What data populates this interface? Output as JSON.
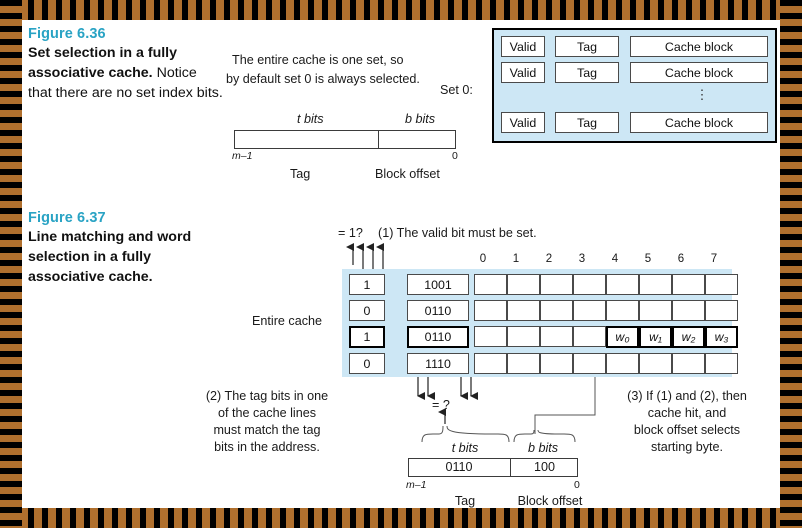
{
  "page": {
    "frame_color_dark": "#000000",
    "frame_color_orange": "#b0702e",
    "cache_fill_color": "#cde7f5",
    "figure_number_color": "#29a3c4"
  },
  "figure_636": {
    "number": "Figure 6.36",
    "caption_bold": "Set selection in a fully associative cache.",
    "caption_rest": " Notice that there are no set index bits.",
    "note_line1": "The entire cache is one set, so",
    "note_line2": "by default set 0 is always selected.",
    "set_label": "Set 0:",
    "address": {
      "t_bits_label": "t bits",
      "b_bits_label": "b bits",
      "left_end_label": "m–1",
      "right_end_label": "0",
      "tag_label": "Tag",
      "block_offset_label": "Block offset"
    },
    "cache_rows": [
      {
        "valid": "Valid",
        "tag": "Tag",
        "block": "Cache block"
      },
      {
        "valid": "Valid",
        "tag": "Tag",
        "block": "Cache block"
      },
      {
        "valid": "Valid",
        "tag": "Tag",
        "block": "Cache block"
      }
    ],
    "ellipsis": "⋮"
  },
  "figure_637": {
    "number": "Figure 6.37",
    "caption_bold": "Line matching and word selection in a fully associative cache.",
    "caption_rest": "",
    "entire_cache_label": "Entire cache",
    "valid_check_label": "= 1?",
    "tag_check_label": "= ?",
    "note1": "(1) The valid bit must be set.",
    "note2_lines": [
      "(2) The tag bits in one",
      "of the cache lines",
      "must match the tag",
      "bits in the address."
    ],
    "note3_lines": [
      "(3) If (1) and (2), then",
      "cache hit, and",
      "block offset selects",
      "starting byte."
    ],
    "block_column_headers": [
      "0",
      "1",
      "2",
      "3",
      "4",
      "5",
      "6",
      "7"
    ],
    "lines": [
      {
        "valid": "1",
        "tag": "1001",
        "highlight": false
      },
      {
        "valid": "0",
        "tag": "0110",
        "highlight": false
      },
      {
        "valid": "1",
        "tag": "0110",
        "highlight": true
      },
      {
        "valid": "0",
        "tag": "1110",
        "highlight": false
      }
    ],
    "words": [
      "w₀",
      "w₁",
      "w₂",
      "w₃"
    ],
    "word_start_col": 4,
    "address": {
      "t_bits_label": "t bits",
      "b_bits_label": "b bits",
      "tag_value": "0110",
      "offset_value": "100",
      "left_end_label": "m–1",
      "right_end_label": "0",
      "tag_label": "Tag",
      "block_offset_label": "Block offset"
    }
  }
}
